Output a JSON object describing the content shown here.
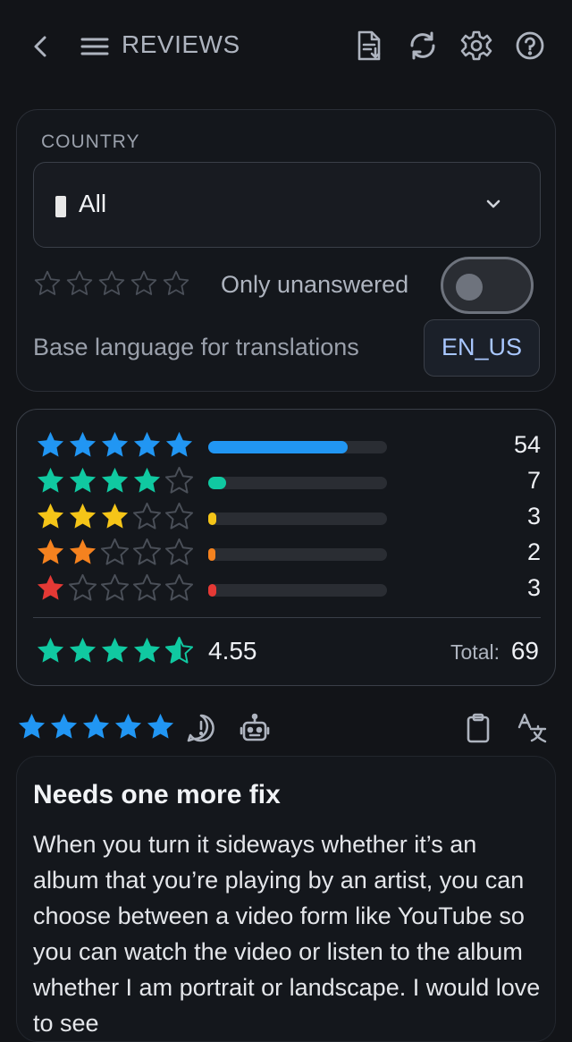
{
  "header": {
    "title": "REVIEWS",
    "icons": [
      "back-arrow-icon",
      "menu-icon",
      "export-document-icon",
      "refresh-icon",
      "settings-gear-icon",
      "help-icon"
    ]
  },
  "filters": {
    "country_label": "COUNTRY",
    "country_value": "All",
    "star_filter_selected": 0,
    "only_unanswered_label": "Only unanswered",
    "only_unanswered_on": false,
    "base_language_label": "Base language for translations",
    "base_language_value": "EN_US"
  },
  "summary": {
    "rows": [
      {
        "stars": 5,
        "count": "54",
        "fraction": 0.78,
        "color": "#2196f3"
      },
      {
        "stars": 4,
        "count": "7",
        "fraction": 0.1,
        "color": "#10c9a1"
      },
      {
        "stars": 3,
        "count": "3",
        "fraction": 0.045,
        "color": "#f5c518"
      },
      {
        "stars": 2,
        "count": "2",
        "fraction": 0.03,
        "color": "#f5821f"
      },
      {
        "stars": 1,
        "count": "3",
        "fraction": 0.045,
        "color": "#e53935"
      }
    ],
    "average": "4.55",
    "average_stars": 4.55,
    "average_color": "#10c9a1",
    "total_label": "Total:",
    "total_value": "69"
  },
  "review": {
    "stars": 5,
    "star_color": "#2196f3",
    "title": "Needs one more fix",
    "body": "When you turn it sideways whether it’s an album that you’re playing by an artist, you can choose between a video form like YouTube so you can watch the video or listen to the album whether I am portrait or landscape. I would love to see"
  },
  "colors": {
    "background": "#121418",
    "empty_star": "#4a4f58",
    "accent_link": "#a9c7ff"
  }
}
